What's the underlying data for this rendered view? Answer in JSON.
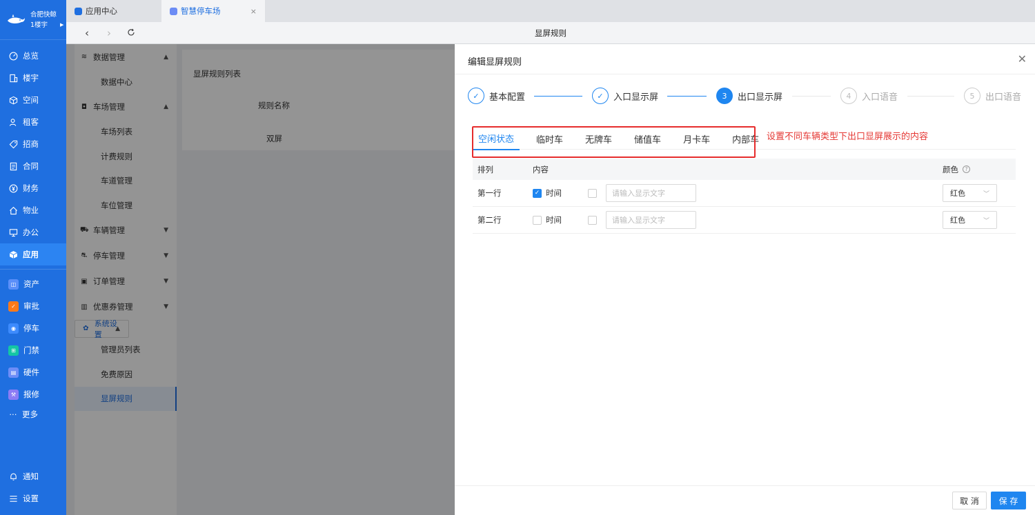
{
  "brand": {
    "line1": "合肥快鲸",
    "line2": "1楼宇"
  },
  "leftnav": {
    "items": [
      {
        "label": "总览",
        "icon": "dashboard-icon"
      },
      {
        "label": "楼宇",
        "icon": "building-icon"
      },
      {
        "label": "空间",
        "icon": "cube-icon"
      },
      {
        "label": "租客",
        "icon": "users-icon"
      },
      {
        "label": "招商",
        "icon": "tag-icon"
      },
      {
        "label": "合同",
        "icon": "document-icon"
      },
      {
        "label": "财务",
        "icon": "yen-icon"
      },
      {
        "label": "物业",
        "icon": "home-icon"
      },
      {
        "label": "办公",
        "icon": "monitor-icon"
      },
      {
        "label": "应用",
        "icon": "app-cube-icon"
      }
    ],
    "apps": [
      {
        "label": "资产",
        "color": "#5b8ff9"
      },
      {
        "label": "审批",
        "color": "#ff7a1a"
      },
      {
        "label": "停车",
        "color": "#3d8bfd"
      },
      {
        "label": "门禁",
        "color": "#14c6a4"
      },
      {
        "label": "硬件",
        "color": "#6d8df7"
      },
      {
        "label": "报修",
        "color": "#8c7cf5"
      },
      {
        "label": "更多",
        "color": ""
      }
    ],
    "bottom": [
      {
        "label": "通知"
      },
      {
        "label": "设置"
      }
    ]
  },
  "tabs": [
    {
      "label": "应用中心"
    },
    {
      "label": "智慧停车场",
      "close": "×"
    }
  ],
  "address": {
    "title": "显屏规则"
  },
  "submenu": {
    "groups": [
      {
        "label": "数据管理",
        "caret": "▲",
        "items": [
          "数据中心"
        ]
      },
      {
        "label": "车场管理",
        "caret": "▲",
        "items": [
          "车场列表",
          "计费规则",
          "车道管理",
          "车位管理"
        ]
      },
      {
        "label": "车辆管理",
        "caret": "▼",
        "items": []
      },
      {
        "label": "停车管理",
        "caret": "▼",
        "items": []
      },
      {
        "label": "订单管理",
        "caret": "▼",
        "items": []
      },
      {
        "label": "优惠券管理",
        "caret": "▼",
        "items": []
      },
      {
        "label": "系统设置",
        "caret": "▲",
        "items": [
          "管理员列表",
          "免费原因",
          "显屏规则"
        ]
      }
    ]
  },
  "listpanel": {
    "title": "显屏规则列表",
    "col_header": "规则名称",
    "cell": "双屏"
  },
  "drawer": {
    "title": "编辑显屏规则",
    "close": "✕",
    "steps": [
      {
        "num": "✓",
        "label": "基本配置",
        "state": "done"
      },
      {
        "num": "✓",
        "label": "入口显示屏",
        "state": "done"
      },
      {
        "num": "3",
        "label": "出口显示屏",
        "state": "current"
      },
      {
        "num": "4",
        "label": "入口语音",
        "state": "todo"
      },
      {
        "num": "5",
        "label": "出口语音",
        "state": "todo"
      }
    ],
    "content_tabs": [
      "空闲状态",
      "临时车",
      "无牌车",
      "储值车",
      "月卡车",
      "内部车"
    ],
    "active_tab": "空闲状态",
    "annotation": "设置不同车辆类型下出口显屏展示的内容",
    "table": {
      "headers": {
        "order": "排列",
        "content": "内容",
        "color": "颜色"
      },
      "rows": [
        {
          "order": "第一行",
          "time_label": "时间",
          "time_checked": true,
          "text_checked": false,
          "placeholder": "请输入显示文字",
          "color": "红色"
        },
        {
          "order": "第二行",
          "time_label": "时间",
          "time_checked": false,
          "text_checked": false,
          "placeholder": "请输入显示文字",
          "color": "红色"
        }
      ]
    },
    "footer": {
      "cancel": "取 消",
      "save": "保 存"
    }
  },
  "colors": {
    "primary": "#1f6fe0",
    "accent": "#1f86f0",
    "annotation": "#e53935"
  }
}
